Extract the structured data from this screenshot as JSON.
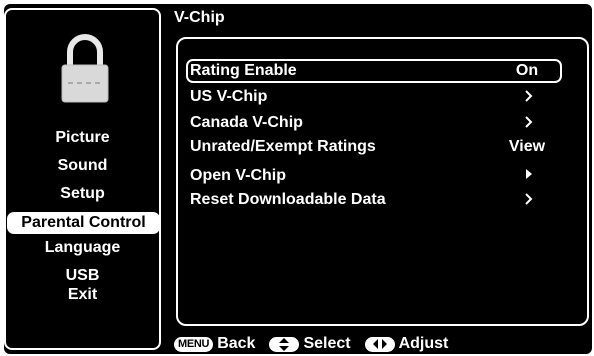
{
  "sidebar": {
    "items": [
      {
        "label": "Picture",
        "selected": false
      },
      {
        "label": "Sound",
        "selected": false
      },
      {
        "label": "Setup",
        "selected": false
      },
      {
        "label": "Parental Control",
        "selected": true
      },
      {
        "label": "Language",
        "selected": false
      },
      {
        "label": "USB",
        "selected": false
      },
      {
        "label": "Exit",
        "selected": false
      }
    ],
    "icon": "padlock-icon"
  },
  "main": {
    "title": "V-Chip",
    "rows": [
      {
        "label": "Rating Enable",
        "value": "On",
        "indicator": "none",
        "focused": true
      },
      {
        "label": "US V-Chip",
        "value": "",
        "indicator": "chevron-right-icon",
        "focused": false
      },
      {
        "label": "Canada V-Chip",
        "value": "",
        "indicator": "chevron-right-icon",
        "focused": false
      },
      {
        "label": "Unrated/Exempt Ratings",
        "value": "View",
        "indicator": "none",
        "focused": false
      },
      {
        "label": "Open V-Chip",
        "value": "",
        "indicator": "triangle-right-icon",
        "focused": false
      },
      {
        "label": "Reset Downloadable Data",
        "value": "",
        "indicator": "chevron-right-icon",
        "focused": false
      }
    ]
  },
  "footer": {
    "menu_key": "MENU",
    "back_label": "Back",
    "select_label": "Select",
    "adjust_label": "Adjust"
  },
  "colors": {
    "background": "#000000",
    "foreground": "#ffffff"
  }
}
